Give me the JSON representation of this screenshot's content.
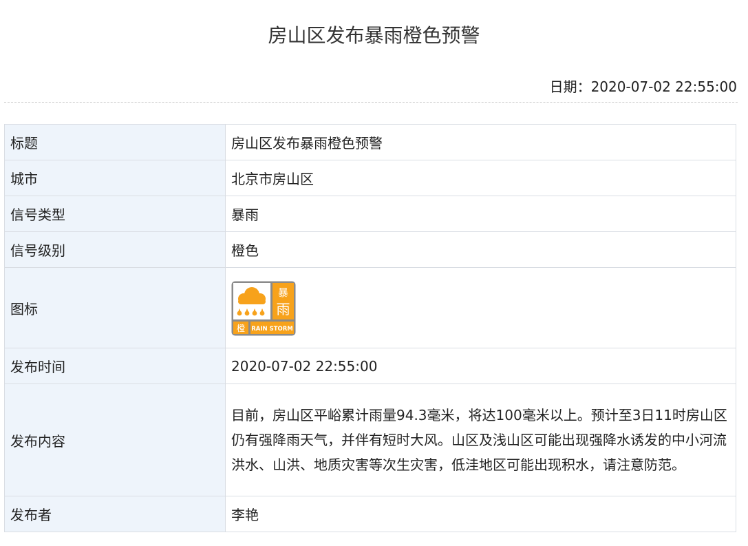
{
  "header": {
    "title": "房山区发布暴雨橙色预警",
    "date_label": "日期：",
    "date_value": "2020-07-02 22:55:00"
  },
  "table": {
    "rows": [
      {
        "key": "标题",
        "value": "房山区发布暴雨橙色预警"
      },
      {
        "key": "城市",
        "value": "北京市房山区"
      },
      {
        "key": "信号类型",
        "value": "暴雨"
      },
      {
        "key": "信号级别",
        "value": "橙色"
      },
      {
        "key": "图标",
        "icon": "rainstorm-orange-warning-icon"
      },
      {
        "key": "发布时间",
        "value": "2020-07-02 22:55:00"
      },
      {
        "key": "发布内容",
        "value": "目前，房山区平峪累计雨量94.3毫米，将达100毫米以上。预计至3日11时房山区仍有强降雨天气，并伴有短时大风。山区及浅山区可能出现强降水诱发的中小河流洪水、山洪、地质灾害等次生灾害，低洼地区可能出现积水，请注意防范。"
      },
      {
        "key": "发布者",
        "value": "李艳"
      }
    ]
  },
  "icon": {
    "top_glyph": "暴",
    "main_glyph": "雨",
    "level_glyph": "橙",
    "caption": "RAIN STORM",
    "colors": {
      "orange": "#f7a21b",
      "frame": "#8a8a8a",
      "white": "#ffffff"
    }
  }
}
